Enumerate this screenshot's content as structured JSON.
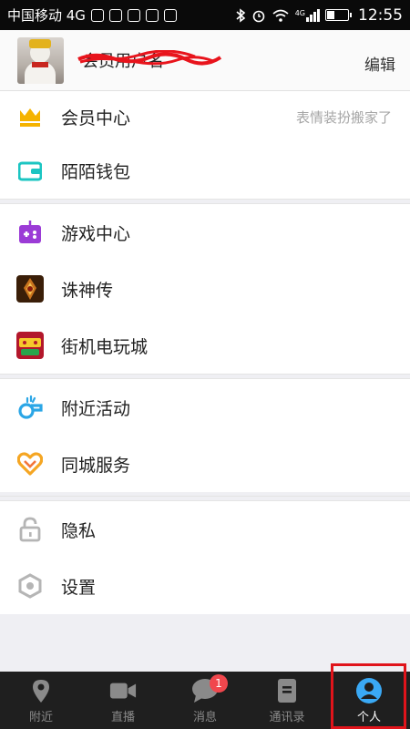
{
  "status_bar": {
    "carrier": "中国移动 4G",
    "network": "4G",
    "time": "12:55",
    "battery_level": 0.35
  },
  "profile": {
    "username": "会员用户名",
    "edit_label": "编辑"
  },
  "menu": {
    "group1": [
      {
        "label": "会员中心",
        "hint": "表情装扮搬家了",
        "icon": "crown-icon",
        "color": "#f5b300"
      },
      {
        "label": "陌陌钱包",
        "icon": "wallet-icon",
        "color": "#1bc5c2"
      }
    ],
    "group2": [
      {
        "label": "游戏中心",
        "icon": "game-controller-icon",
        "color": "#9b3bd6"
      },
      {
        "label": "诛神传",
        "icon": "zhushenzhuan-game-icon"
      },
      {
        "label": "街机电玩城",
        "icon": "arcade-game-icon"
      }
    ],
    "group3": [
      {
        "label": "附近活动",
        "icon": "whistle-icon",
        "color": "#2ba6e6"
      },
      {
        "label": "同城服务",
        "icon": "heart-icon",
        "color": "#f5a623"
      }
    ],
    "group4": [
      {
        "label": "隐私",
        "icon": "lock-icon",
        "color": "#b5b5b5"
      },
      {
        "label": "设置",
        "icon": "settings-hexagon-icon",
        "color": "#b5b5b5"
      }
    ]
  },
  "tabbar": {
    "tabs": [
      {
        "label": "附近",
        "icon": "location-pin-icon"
      },
      {
        "label": "直播",
        "icon": "video-camera-icon"
      },
      {
        "label": "消息",
        "icon": "chat-bubble-icon",
        "badge": "1"
      },
      {
        "label": "通讯录",
        "icon": "contacts-book-icon"
      },
      {
        "label": "个人",
        "icon": "person-icon",
        "active": true
      }
    ],
    "active_color": "#3aa9f5"
  }
}
